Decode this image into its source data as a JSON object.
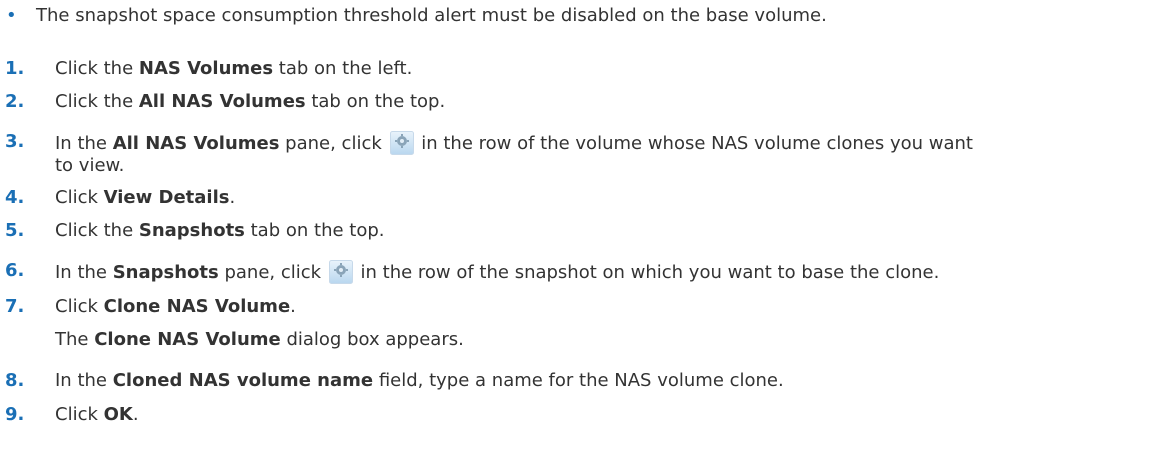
{
  "prereq": {
    "bullet": "•",
    "text": "The snapshot space consumption threshold alert must be disabled on the base volume."
  },
  "steps": [
    {
      "num": "1.",
      "pre": "Click the ",
      "b1": "NAS Volumes",
      "post": " tab on the left."
    },
    {
      "num": "2.",
      "pre": "Click the ",
      "b1": "All NAS Volumes",
      "post": " tab on the top."
    },
    {
      "num": "3.",
      "pre": "In the ",
      "b1": "All NAS Volumes",
      "mid": " pane, click ",
      "post": " in the row of the volume whose NAS volume clones you want",
      "cont": "to view."
    },
    {
      "num": "4.",
      "pre": "Click ",
      "b1": "View Details",
      "post": "."
    },
    {
      "num": "5.",
      "pre": "Click the ",
      "b1": "Snapshots",
      "post": " tab on the top."
    },
    {
      "num": "6.",
      "pre": "In the ",
      "b1": "Snapshots",
      "mid": " pane, click ",
      "post": " in the row of the snapshot on which you want to base the clone."
    },
    {
      "num": "7.",
      "pre": "Click ",
      "b1": "Clone NAS Volume",
      "post": ".",
      "result_pre": "The ",
      "result_b": "Clone NAS Volume",
      "result_post": " dialog box appears."
    },
    {
      "num": "8.",
      "pre": "In the ",
      "b1": "Cloned NAS volume name",
      "post": " field, type a name for the NAS volume clone."
    },
    {
      "num": "9.",
      "pre": "Click ",
      "b1": "OK",
      "post": "."
    }
  ],
  "icons": {
    "gear": "gear-icon"
  },
  "colors": {
    "accent": "#1a6fb5",
    "text": "#333333"
  }
}
